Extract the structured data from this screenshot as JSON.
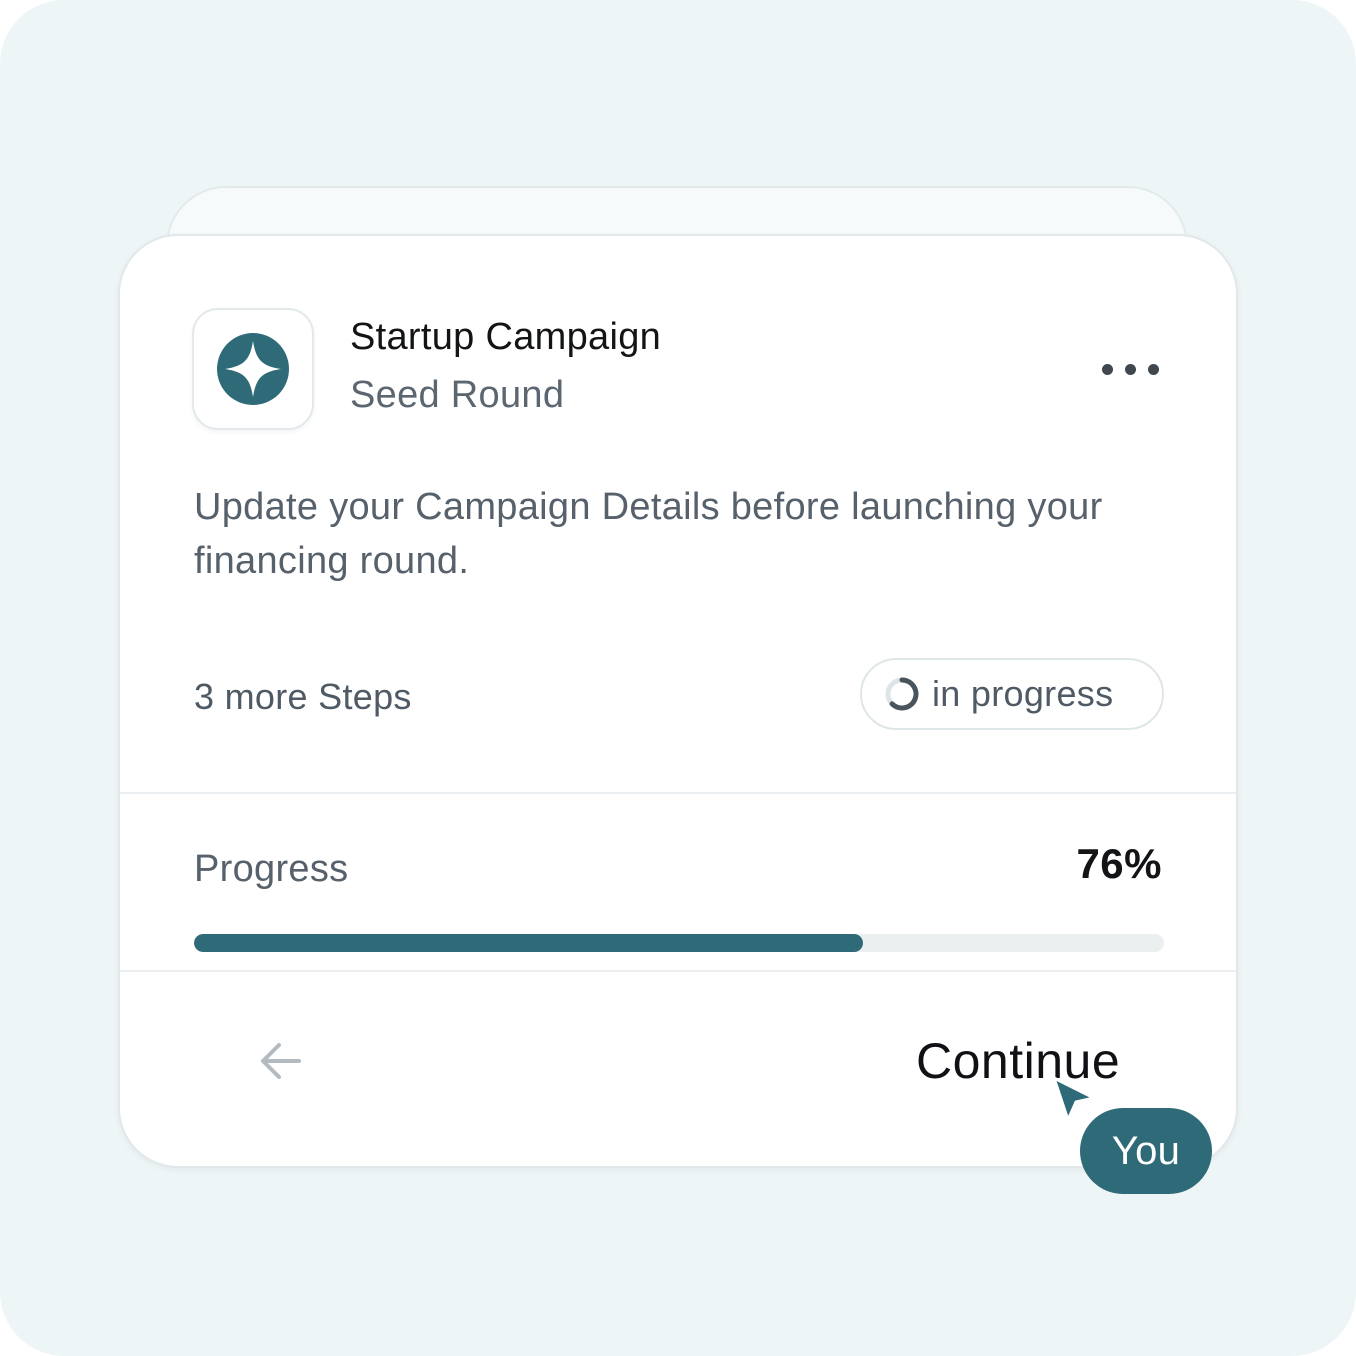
{
  "campaign": {
    "title": "Startup Campaign",
    "subtitle": "Seed Round",
    "logo_icon": "four-point-star-logo-icon",
    "menu_icon": "more-horizontal-icon"
  },
  "description": "Update your Campaign Details before launching your financing round.",
  "steps_label": "3 more Steps",
  "status": {
    "label": "in progress",
    "icon": "spinner-icon"
  },
  "progress": {
    "label": "Progress",
    "value_text": "76%",
    "fraction": 0.69
  },
  "footer": {
    "back_icon": "arrow-left-icon",
    "continue_label": "Continue"
  },
  "cursor": {
    "label": "You",
    "icon": "pointer-cursor-icon"
  },
  "colors": {
    "accent": "#2e6a77",
    "background": "#eef5f6",
    "text_primary": "#121416",
    "text_secondary": "#56616b"
  }
}
